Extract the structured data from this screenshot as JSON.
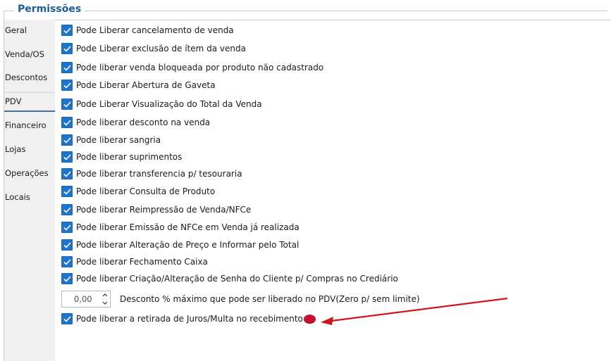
{
  "group": {
    "title": "Permissões"
  },
  "sidebar": {
    "items": [
      {
        "label": "Geral"
      },
      {
        "label": "Venda/OS"
      },
      {
        "label": "Descontos"
      },
      {
        "label": "PDV"
      },
      {
        "label": "Financeiro"
      },
      {
        "label": "Lojas"
      },
      {
        "label": "Operações"
      },
      {
        "label": "Locais"
      }
    ],
    "active": "PDV"
  },
  "permissions": [
    {
      "label": "Pode Liberar cancelamento de venda",
      "checked": true
    },
    {
      "label": "Pode Liberar exclusão de ítem da venda",
      "checked": true
    },
    {
      "label": "Pode liberar venda bloqueada por produto não cadastrado",
      "checked": true
    },
    {
      "label": "Pode Liberar Abertura de Gaveta",
      "checked": true
    },
    {
      "label": "Pode Liberar Visualização do Total da Venda",
      "checked": true
    },
    {
      "label": "Pode liberar desconto na venda",
      "checked": true
    },
    {
      "label": "Pode liberar sangria",
      "checked": true
    },
    {
      "label": "Pode liberar suprimentos",
      "checked": true
    },
    {
      "label": "Pode liberar transferencia p/ tesouraria",
      "checked": true
    },
    {
      "label": "Pode liberar Consulta de Produto",
      "checked": true
    },
    {
      "label": "Pode liberar Reimpressão de Venda/NFCe",
      "checked": true
    },
    {
      "label": "Pode liberar Emissão de NFCe em Venda já realizada",
      "checked": true
    },
    {
      "label": "Pode liberar Alteração de Preço e Informar pelo Total",
      "checked": true
    },
    {
      "label": "Pode liberar Fechamento Caixa",
      "checked": true
    },
    {
      "label": "Pode liberar Criação/Alteração de Senha do Cliente p/ Compras no Crediário",
      "checked": true
    }
  ],
  "discount": {
    "value": "0,00",
    "label": "Desconto % máximo que pode ser liberado no PDV(Zero p/ sem limite)"
  },
  "last_permission": {
    "label": "Pode liberar a retirada de Juros/Multa no recebimento",
    "checked": true,
    "badge_icon": "novo-badge-icon"
  },
  "colors": {
    "accent": "#1f73c8",
    "title": "#1b5b9c",
    "arrow": "#d0161b",
    "badge": "#c8102e"
  }
}
